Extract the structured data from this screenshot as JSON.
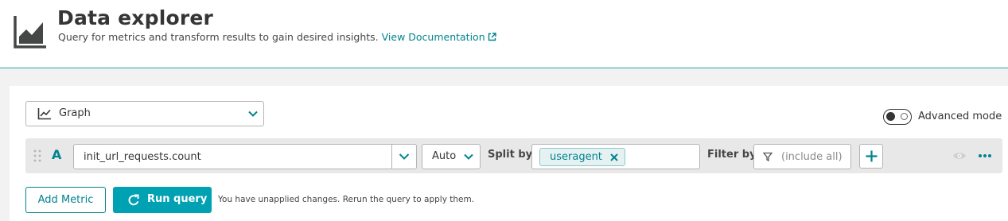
{
  "header": {
    "title": "Data explorer",
    "subtitle": "Query for metrics and transform results to gain desired insights.",
    "doc_link": "View Documentation",
    "logo_icon": "area-chart-icon",
    "link_icon": "external-link-icon"
  },
  "visualization": {
    "selected": "Graph",
    "icon": "line-chart-icon"
  },
  "advanced_mode": {
    "label": "Advanced mode",
    "enabled": false
  },
  "query": {
    "letter": "A",
    "metric": "init_url_requests.count",
    "aggregation": "Auto",
    "split_by_label": "Split by",
    "split_by_values": [
      "useragent"
    ],
    "filter_by_label": "Filter by",
    "filter_placeholder": "(include all)"
  },
  "actions": {
    "add_metric": "Add Metric",
    "run_query": "Run query",
    "unapplied_notice": "You have unapplied changes. Rerun the query to apply them."
  },
  "colors": {
    "accent": "#00a1b2",
    "link": "#00838f",
    "divider": "#2aa3b1"
  }
}
